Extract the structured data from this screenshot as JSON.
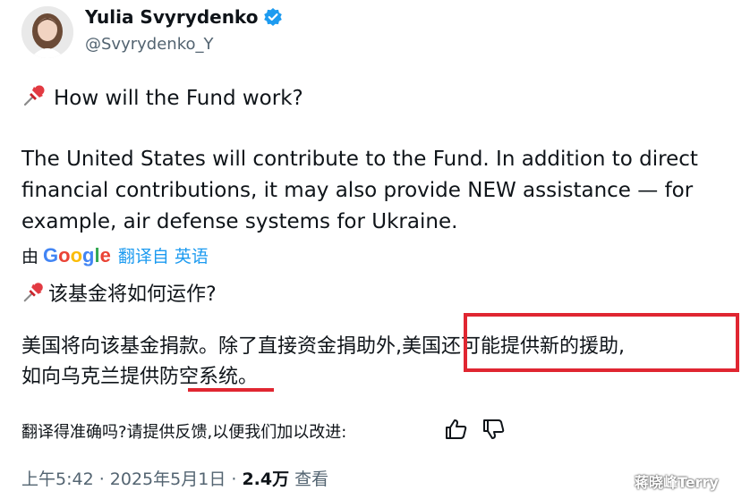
{
  "author": {
    "display_name": "Yulia Svyrydenko",
    "handle": "@Svyrydenko_Y",
    "verified_icon": "verified-badge-icon"
  },
  "post": {
    "heading": "How will the Fund work?",
    "body_lines": [
      "The United States will contribute to the Fund. In addition to direct",
      "financial contributions, it may also provide NEW assistance — for",
      "example, air defense systems for Ukraine."
    ]
  },
  "translation": {
    "by_label": "由",
    "provider": "Google",
    "link_label": "翻译自 英语",
    "heading": "该基金将如何运作?",
    "line1": "美国将向该基金捐款。除了直接资金捐助外,美国还可能提供新的援助,",
    "line2": "如向乌克兰提供防空系统。",
    "feedback": "翻译得准确吗?请提供反馈,以便我们加以改进:"
  },
  "meta": {
    "time_date": "上午5:42 · 2025年5月1日 · ",
    "views_count": "2.4万",
    "views_label": " 查看"
  },
  "watermark": "蒋晓峰Terry",
  "colors": {
    "highlight_red": "#e02631",
    "link_blue": "#1d9bf0",
    "muted_gray": "#536471"
  }
}
